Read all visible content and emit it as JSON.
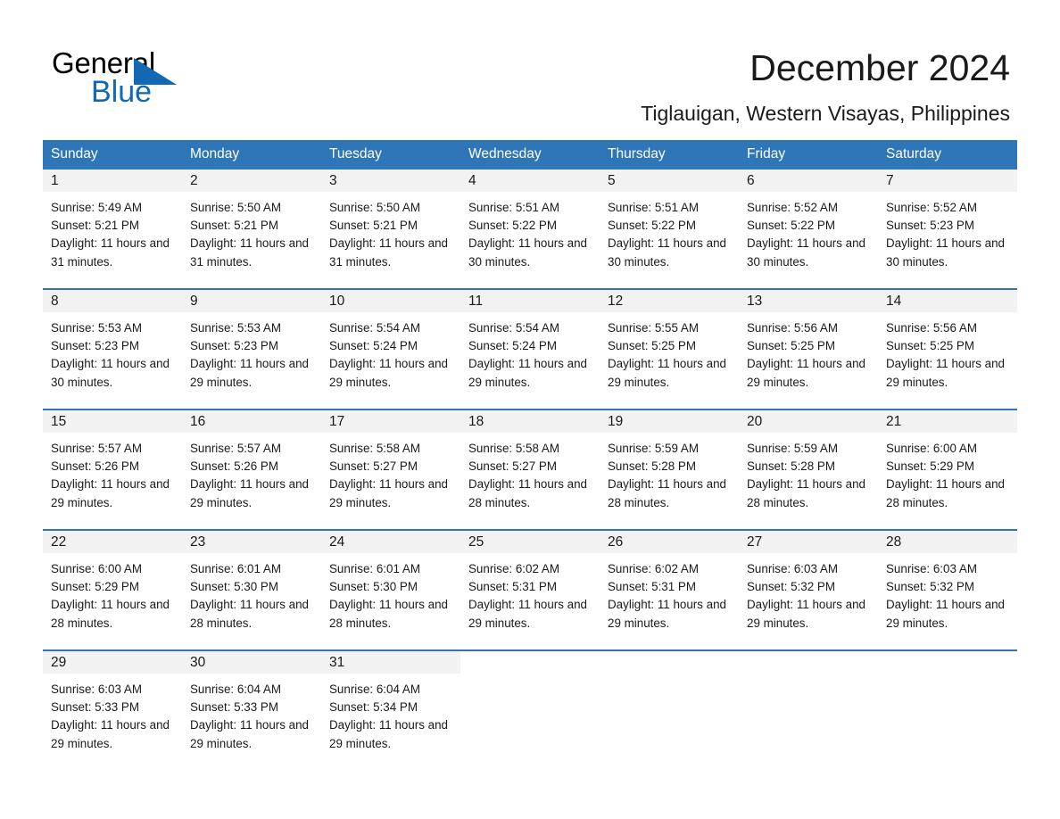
{
  "brand": {
    "name_part1": "General",
    "name_part2": "Blue",
    "triangle_color": "#1268b3",
    "accent_color": "#2e76b8"
  },
  "header": {
    "title": "December 2024",
    "subtitle": "Tiglauigan, Western Visayas, Philippines"
  },
  "calendar": {
    "weekday_headers": [
      "Sunday",
      "Monday",
      "Tuesday",
      "Wednesday",
      "Thursday",
      "Friday",
      "Saturday"
    ],
    "labels": {
      "sunrise_prefix": "Sunrise:",
      "sunset_prefix": "Sunset:",
      "daylight_prefix": "Daylight:"
    },
    "weeks": [
      [
        {
          "date": "1",
          "sunrise": "Sunrise: 5:49 AM",
          "sunset": "Sunset: 5:21 PM",
          "daylight": "Daylight: 11 hours and 31 minutes."
        },
        {
          "date": "2",
          "sunrise": "Sunrise: 5:50 AM",
          "sunset": "Sunset: 5:21 PM",
          "daylight": "Daylight: 11 hours and 31 minutes."
        },
        {
          "date": "3",
          "sunrise": "Sunrise: 5:50 AM",
          "sunset": "Sunset: 5:21 PM",
          "daylight": "Daylight: 11 hours and 31 minutes."
        },
        {
          "date": "4",
          "sunrise": "Sunrise: 5:51 AM",
          "sunset": "Sunset: 5:22 PM",
          "daylight": "Daylight: 11 hours and 30 minutes."
        },
        {
          "date": "5",
          "sunrise": "Sunrise: 5:51 AM",
          "sunset": "Sunset: 5:22 PM",
          "daylight": "Daylight: 11 hours and 30 minutes."
        },
        {
          "date": "6",
          "sunrise": "Sunrise: 5:52 AM",
          "sunset": "Sunset: 5:22 PM",
          "daylight": "Daylight: 11 hours and 30 minutes."
        },
        {
          "date": "7",
          "sunrise": "Sunrise: 5:52 AM",
          "sunset": "Sunset: 5:23 PM",
          "daylight": "Daylight: 11 hours and 30 minutes."
        }
      ],
      [
        {
          "date": "8",
          "sunrise": "Sunrise: 5:53 AM",
          "sunset": "Sunset: 5:23 PM",
          "daylight": "Daylight: 11 hours and 30 minutes."
        },
        {
          "date": "9",
          "sunrise": "Sunrise: 5:53 AM",
          "sunset": "Sunset: 5:23 PM",
          "daylight": "Daylight: 11 hours and 29 minutes."
        },
        {
          "date": "10",
          "sunrise": "Sunrise: 5:54 AM",
          "sunset": "Sunset: 5:24 PM",
          "daylight": "Daylight: 11 hours and 29 minutes."
        },
        {
          "date": "11",
          "sunrise": "Sunrise: 5:54 AM",
          "sunset": "Sunset: 5:24 PM",
          "daylight": "Daylight: 11 hours and 29 minutes."
        },
        {
          "date": "12",
          "sunrise": "Sunrise: 5:55 AM",
          "sunset": "Sunset: 5:25 PM",
          "daylight": "Daylight: 11 hours and 29 minutes."
        },
        {
          "date": "13",
          "sunrise": "Sunrise: 5:56 AM",
          "sunset": "Sunset: 5:25 PM",
          "daylight": "Daylight: 11 hours and 29 minutes."
        },
        {
          "date": "14",
          "sunrise": "Sunrise: 5:56 AM",
          "sunset": "Sunset: 5:25 PM",
          "daylight": "Daylight: 11 hours and 29 minutes."
        }
      ],
      [
        {
          "date": "15",
          "sunrise": "Sunrise: 5:57 AM",
          "sunset": "Sunset: 5:26 PM",
          "daylight": "Daylight: 11 hours and 29 minutes."
        },
        {
          "date": "16",
          "sunrise": "Sunrise: 5:57 AM",
          "sunset": "Sunset: 5:26 PM",
          "daylight": "Daylight: 11 hours and 29 minutes."
        },
        {
          "date": "17",
          "sunrise": "Sunrise: 5:58 AM",
          "sunset": "Sunset: 5:27 PM",
          "daylight": "Daylight: 11 hours and 29 minutes."
        },
        {
          "date": "18",
          "sunrise": "Sunrise: 5:58 AM",
          "sunset": "Sunset: 5:27 PM",
          "daylight": "Daylight: 11 hours and 28 minutes."
        },
        {
          "date": "19",
          "sunrise": "Sunrise: 5:59 AM",
          "sunset": "Sunset: 5:28 PM",
          "daylight": "Daylight: 11 hours and 28 minutes."
        },
        {
          "date": "20",
          "sunrise": "Sunrise: 5:59 AM",
          "sunset": "Sunset: 5:28 PM",
          "daylight": "Daylight: 11 hours and 28 minutes."
        },
        {
          "date": "21",
          "sunrise": "Sunrise: 6:00 AM",
          "sunset": "Sunset: 5:29 PM",
          "daylight": "Daylight: 11 hours and 28 minutes."
        }
      ],
      [
        {
          "date": "22",
          "sunrise": "Sunrise: 6:00 AM",
          "sunset": "Sunset: 5:29 PM",
          "daylight": "Daylight: 11 hours and 28 minutes."
        },
        {
          "date": "23",
          "sunrise": "Sunrise: 6:01 AM",
          "sunset": "Sunset: 5:30 PM",
          "daylight": "Daylight: 11 hours and 28 minutes."
        },
        {
          "date": "24",
          "sunrise": "Sunrise: 6:01 AM",
          "sunset": "Sunset: 5:30 PM",
          "daylight": "Daylight: 11 hours and 28 minutes."
        },
        {
          "date": "25",
          "sunrise": "Sunrise: 6:02 AM",
          "sunset": "Sunset: 5:31 PM",
          "daylight": "Daylight: 11 hours and 29 minutes."
        },
        {
          "date": "26",
          "sunrise": "Sunrise: 6:02 AM",
          "sunset": "Sunset: 5:31 PM",
          "daylight": "Daylight: 11 hours and 29 minutes."
        },
        {
          "date": "27",
          "sunrise": "Sunrise: 6:03 AM",
          "sunset": "Sunset: 5:32 PM",
          "daylight": "Daylight: 11 hours and 29 minutes."
        },
        {
          "date": "28",
          "sunrise": "Sunrise: 6:03 AM",
          "sunset": "Sunset: 5:32 PM",
          "daylight": "Daylight: 11 hours and 29 minutes."
        }
      ],
      [
        {
          "date": "29",
          "sunrise": "Sunrise: 6:03 AM",
          "sunset": "Sunset: 5:33 PM",
          "daylight": "Daylight: 11 hours and 29 minutes."
        },
        {
          "date": "30",
          "sunrise": "Sunrise: 6:04 AM",
          "sunset": "Sunset: 5:33 PM",
          "daylight": "Daylight: 11 hours and 29 minutes."
        },
        {
          "date": "31",
          "sunrise": "Sunrise: 6:04 AM",
          "sunset": "Sunset: 5:34 PM",
          "daylight": "Daylight: 11 hours and 29 minutes."
        },
        {
          "date": "",
          "sunrise": "",
          "sunset": "",
          "daylight": ""
        },
        {
          "date": "",
          "sunrise": "",
          "sunset": "",
          "daylight": ""
        },
        {
          "date": "",
          "sunrise": "",
          "sunset": "",
          "daylight": ""
        },
        {
          "date": "",
          "sunrise": "",
          "sunset": "",
          "daylight": ""
        }
      ]
    ]
  }
}
